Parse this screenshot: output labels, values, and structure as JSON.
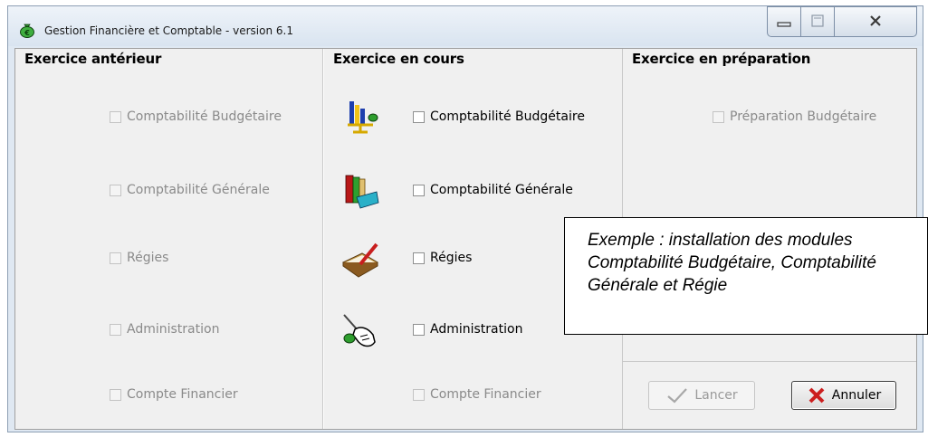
{
  "window": {
    "title": "Gestion Financière et Comptable - version 6.1",
    "icon": "money-bag-icon"
  },
  "panels": {
    "previous": {
      "heading": "Exercice antérieur",
      "items": [
        "Comptabilité Budgétaire",
        "Comptabilité Générale",
        "Régies",
        "Administration",
        "Compte Financier"
      ]
    },
    "current": {
      "heading": "Exercice en cours",
      "items": [
        "Comptabilité Budgétaire",
        "Comptabilité Générale",
        "Régies",
        "Administration",
        "Compte Financier"
      ],
      "icons": [
        "budget-scale-icon",
        "books-icon",
        "ledger-pen-icon",
        "admin-hand-icon"
      ]
    },
    "preparation": {
      "heading": "Exercice en préparation",
      "items": [
        "Préparation Budgétaire"
      ]
    }
  },
  "buttons": {
    "launch": "Lancer",
    "cancel": "Annuler"
  },
  "note": {
    "line1": "Exemple : installation des modules",
    "line2": "Comptabilité Budgétaire, Comptabilité",
    "line3": "Générale et Régie"
  },
  "colors": {
    "titlebar": "#dfe8f2",
    "cancel_x": "#cc1f1f",
    "check_green": "#2e8b2e"
  }
}
